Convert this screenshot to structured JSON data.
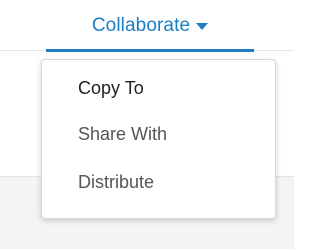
{
  "tab": {
    "label": "Collaborate",
    "icon": "caret-down-icon",
    "color": "#1a7fc4"
  },
  "menu": {
    "items": [
      {
        "label": "Copy To"
      },
      {
        "label": "Share With"
      },
      {
        "label": "Distribute"
      }
    ]
  }
}
